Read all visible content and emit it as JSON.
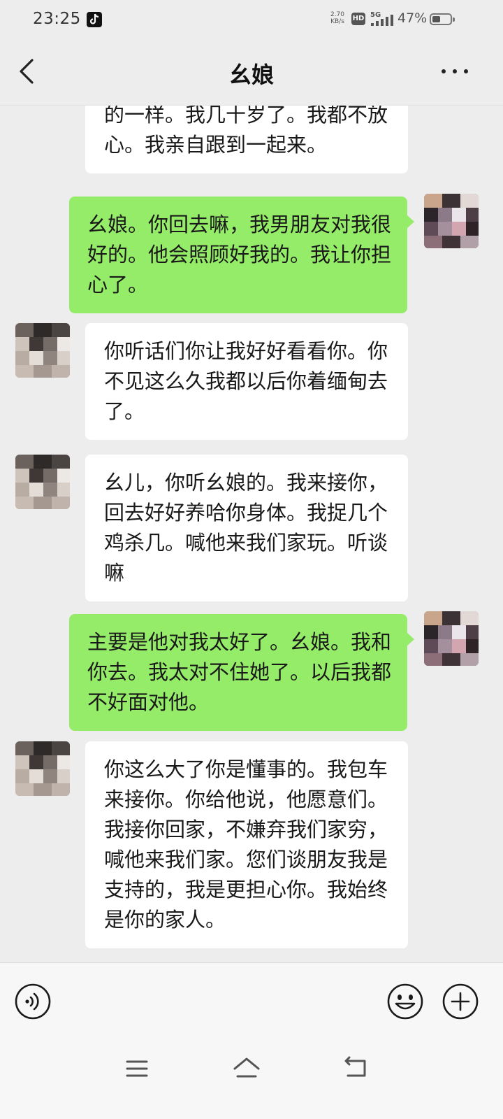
{
  "status_bar": {
    "time": "23:25",
    "net_speed_value": "2.70",
    "net_speed_unit": "KB/s",
    "hd_label": "HD",
    "network_label": "5G",
    "battery_percent": "47%",
    "battery_level": 0.47,
    "notification_icon": "tiktok-icon"
  },
  "header": {
    "title": "幺娘",
    "back_icon": "chevron-left-icon",
    "more_icon": "more-dots-icon"
  },
  "messages": [
    {
      "side": "left",
      "text": "的一样。我几十岁了。我都不放心。我亲自跟到一起来。"
    },
    {
      "side": "right",
      "text": "幺娘。你回去嘛，我男朋友对我很好的。他会照顾好我的。我让你担心了。"
    },
    {
      "side": "left",
      "text": "你听话们你让我好好看看你。你不见这么久我都以后你着缅甸去了。"
    },
    {
      "side": "left",
      "text": "幺儿，你听幺娘的。我来接你，回去好好养哈你身体。我捉几个鸡杀几。喊他来我们家玩。听谈嘛"
    },
    {
      "side": "right",
      "text": "主要是他对我太好了。幺娘。我和你去。我太对不住她了。以后我都不好面对他。"
    },
    {
      "side": "left",
      "text": "你这么大了你是懂事的。我包车来接你。你给他说，他愿意们。我接你回家，不嫌弃我们家穷，喊他来我们家。您们谈朋友我是支持的，我是更担心你。我始终是你的家人。"
    }
  ],
  "input_bar": {
    "voice_icon": "voice-icon",
    "emoji_icon": "emoji-icon",
    "plus_icon": "plus-icon"
  },
  "system_nav": {
    "menu_icon": "menu-icon",
    "home_icon": "home-icon",
    "back_icon": "back-arrow-icon"
  },
  "colors": {
    "background": "#ededed",
    "sent_bubble": "#95ec69",
    "received_bubble": "#ffffff",
    "text": "#191919"
  }
}
